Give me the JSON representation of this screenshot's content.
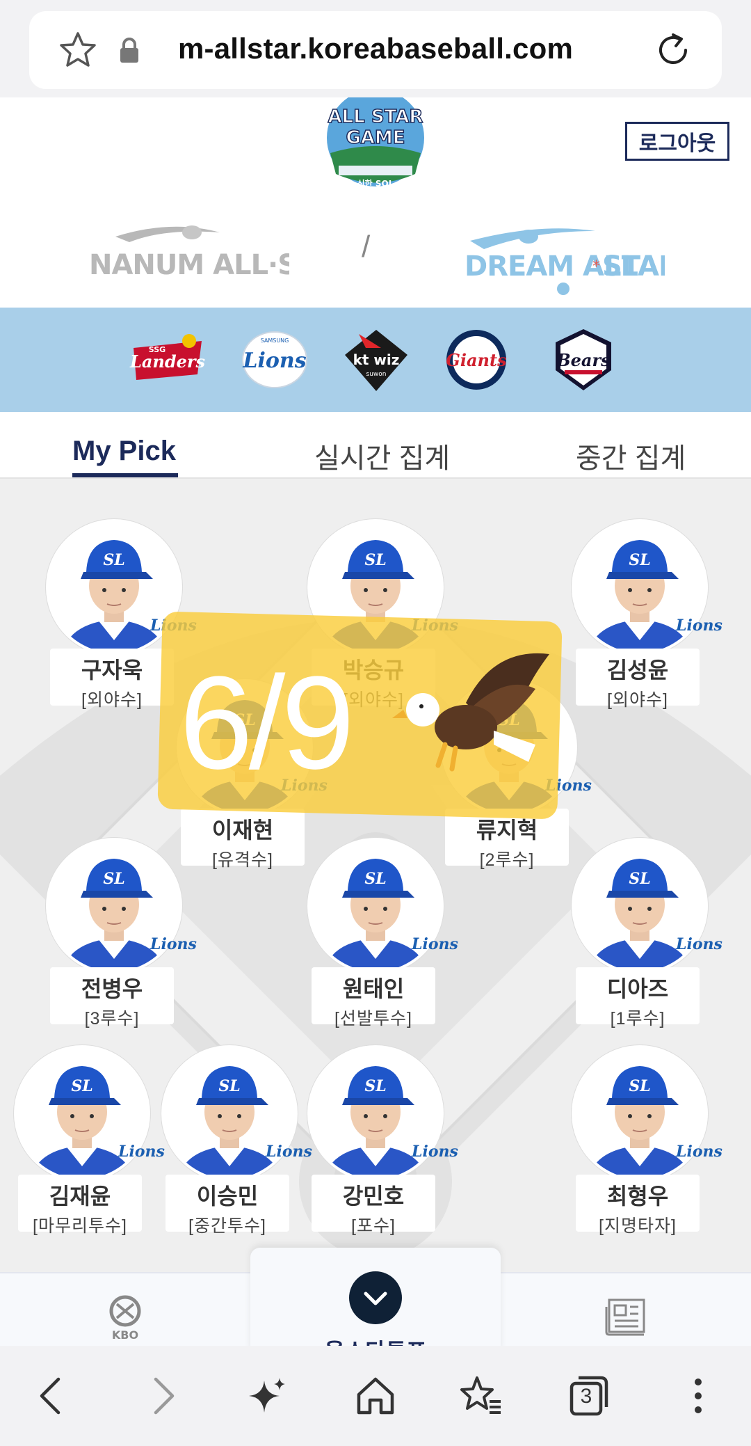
{
  "browser": {
    "url": "m-allstar.koreabaseball.com",
    "icons": [
      "star-icon",
      "lock-icon",
      "reload-icon"
    ],
    "bottom_bar": [
      "back-icon",
      "forward-icon",
      "sparkle-icon",
      "home-icon",
      "bookmarks-icon",
      "tabs-icon",
      "more-icon"
    ],
    "tab_count": "3"
  },
  "header": {
    "logout_label": "로그아웃",
    "logo_text": "ALL STAR GAME",
    "leagues": [
      "NANUM ALL STAR",
      "DREAM ALL STAR"
    ],
    "league_separator": "/",
    "active_league": "DREAM ALL STAR"
  },
  "teams": [
    "SSG Landers",
    "Samsung Lions",
    "kt wiz",
    "Lotte Giants",
    "Doosan Bears"
  ],
  "tabs": [
    {
      "label": "My Pick",
      "active": true
    },
    {
      "label": "실시간 집계",
      "active": false
    },
    {
      "label": "중간 집계",
      "active": false
    }
  ],
  "players": [
    {
      "name": "구자욱",
      "position": "[외야수]"
    },
    {
      "name": "박승규",
      "position": "[외야수]"
    },
    {
      "name": "김성윤",
      "position": "[외야수]"
    },
    {
      "name": "이재현",
      "position": "[유격수]"
    },
    {
      "name": "류지혁",
      "position": "[2루수]"
    },
    {
      "name": "전병우",
      "position": "[3루수]"
    },
    {
      "name": "원태인",
      "position": "[선발투수]"
    },
    {
      "name": "디아즈",
      "position": "[1루수]"
    },
    {
      "name": "김재윤",
      "position": "[마무리투수]"
    },
    {
      "name": "이승민",
      "position": "[중간투수]"
    },
    {
      "name": "강민호",
      "position": "[포수]"
    },
    {
      "name": "최형우",
      "position": "[지명타자]"
    }
  ],
  "team_badge": "Lions",
  "overlay": {
    "count": "6/9",
    "emoji_icon": "eagle-icon"
  },
  "colors": {
    "navy": "#1c2a5a",
    "team_bar": "#a9cfe9",
    "overlay": "#facd3c"
  },
  "bottom_nav": {
    "vote_label": "올스타투표"
  }
}
